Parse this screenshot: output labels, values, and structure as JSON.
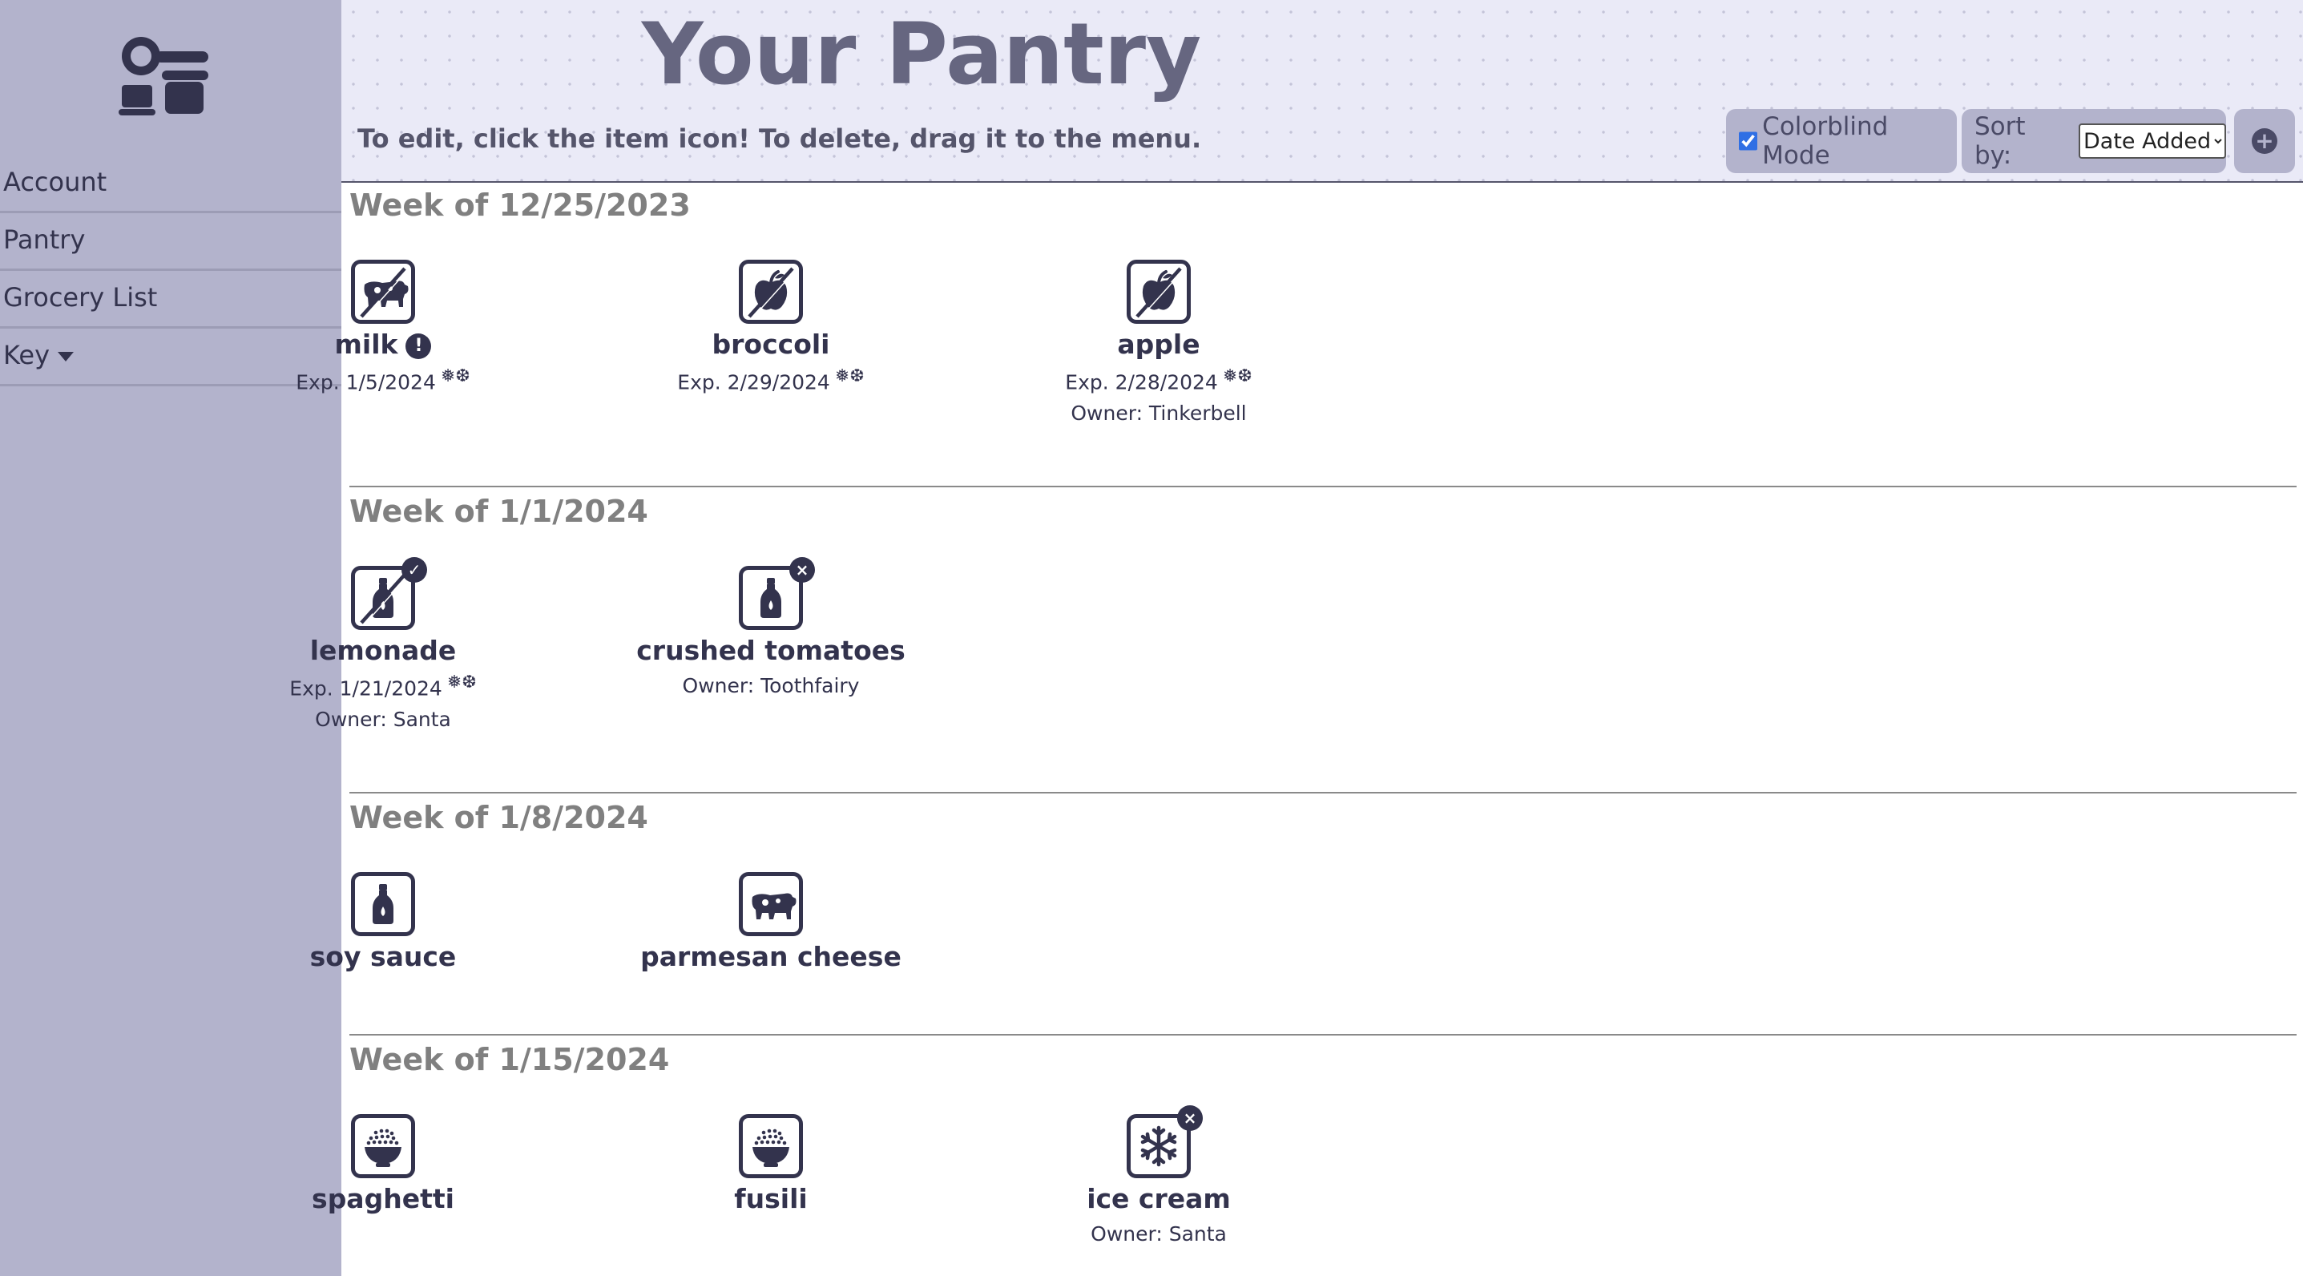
{
  "sidebar": {
    "logo_icon": "kitchen-utensils-icon",
    "nav": [
      "Account",
      "Pantry",
      "Grocery List",
      "Key"
    ]
  },
  "header": {
    "title": "Your Pantry",
    "instructions": "To edit, click the item icon! To delete, drag it to the menu.",
    "colorblind_label": "Colorblind Mode",
    "colorblind_checked": true,
    "sort_label": "Sort by:",
    "sort_value": "Date Added",
    "add_icon": "plus-circle-icon"
  },
  "weeks": [
    {
      "heading": "Week of 12/25/2023",
      "items": [
        {
          "name": "milk",
          "icon": "dairy-cow-icon",
          "crossed": true,
          "alert": "!",
          "exp": "Exp. 1/5/2024",
          "frozen": true
        },
        {
          "name": "broccoli",
          "icon": "produce-apple-icon",
          "crossed": true,
          "exp": "Exp. 2/29/2024",
          "frozen": true
        },
        {
          "name": "apple",
          "icon": "produce-apple-icon",
          "crossed": true,
          "exp": "Exp. 2/28/2024",
          "frozen": true,
          "owner": "Owner: Tinkerbell"
        }
      ]
    },
    {
      "heading": "Week of 1/1/2024",
      "items": [
        {
          "name": "lemonade",
          "icon": "bottle-icon",
          "crossed": true,
          "badge": "✓",
          "exp": "Exp. 1/21/2024",
          "frozen": true,
          "owner": "Owner: Santa"
        },
        {
          "name": "crushed tomatoes",
          "icon": "bottle-icon",
          "badge": "×",
          "owner": "Owner: Toothfairy"
        }
      ]
    },
    {
      "heading": "Week of 1/8/2024",
      "items": [
        {
          "name": "soy sauce",
          "icon": "bottle-icon"
        },
        {
          "name": "parmesan cheese",
          "icon": "dairy-cow-icon"
        }
      ]
    },
    {
      "heading": "Week of 1/15/2024",
      "items": [
        {
          "name": "spaghetti",
          "icon": "grain-bowl-icon"
        },
        {
          "name": "fusili",
          "icon": "grain-bowl-icon"
        },
        {
          "name": "ice cream",
          "icon": "snowflake-icon",
          "badge": "×",
          "owner": "Owner: Santa"
        }
      ]
    }
  ],
  "colors": {
    "sidebar": "#b3b3cc",
    "header": "#eaeaf7",
    "ink": "#33334d"
  }
}
